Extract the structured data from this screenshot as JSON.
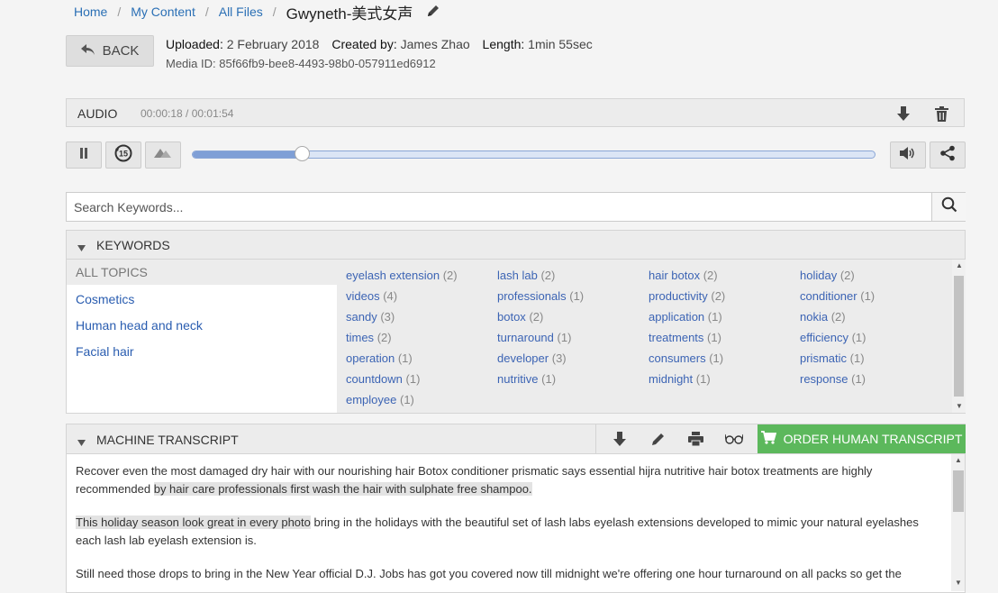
{
  "breadcrumb": {
    "items": [
      "Home",
      "My Content",
      "All Files"
    ],
    "current": "Gwyneth-美式女声",
    "separator": "/"
  },
  "back_button": {
    "label": "BACK"
  },
  "media_info": {
    "uploaded_label": "Uploaded:",
    "uploaded_value": "2 February 2018",
    "created_label": "Created by:",
    "created_value": "James Zhao",
    "length_label": "Length:",
    "length_value": "1min 55sec",
    "media_id": "Media ID: 85f66fb9-bee8-4493-98b0-057911ed6912"
  },
  "audio": {
    "label": "AUDIO",
    "time": "00:00:18 / 00:01:54",
    "progress": 0.16,
    "skip_back_seconds": "15"
  },
  "search": {
    "placeholder": "Search Keywords..."
  },
  "keywords": {
    "header": "KEYWORDS",
    "all_topics": "ALL TOPICS",
    "topics": [
      "Cosmetics",
      "Human head and neck",
      "Facial hair"
    ],
    "columns": [
      [
        {
          "term": "eyelash extension",
          "count": "(2)"
        },
        {
          "term": "videos",
          "count": "(4)"
        },
        {
          "term": "sandy",
          "count": "(3)"
        },
        {
          "term": "times",
          "count": "(2)"
        },
        {
          "term": "operation",
          "count": "(1)"
        },
        {
          "term": "countdown",
          "count": "(1)"
        },
        {
          "term": "employee",
          "count": "(1)"
        }
      ],
      [
        {
          "term": "lash lab",
          "count": "(2)"
        },
        {
          "term": "professionals",
          "count": "(1)"
        },
        {
          "term": "botox",
          "count": "(2)"
        },
        {
          "term": "turnaround",
          "count": "(1)"
        },
        {
          "term": "developer",
          "count": "(3)"
        },
        {
          "term": "nutritive",
          "count": "(1)"
        }
      ],
      [
        {
          "term": "hair botox",
          "count": "(2)"
        },
        {
          "term": "productivity",
          "count": "(2)"
        },
        {
          "term": "application",
          "count": "(1)"
        },
        {
          "term": "treatments",
          "count": "(1)"
        },
        {
          "term": "consumers",
          "count": "(1)"
        },
        {
          "term": "midnight",
          "count": "(1)"
        }
      ],
      [
        {
          "term": "holiday",
          "count": "(2)"
        },
        {
          "term": "conditioner",
          "count": "(1)"
        },
        {
          "term": "nokia",
          "count": "(2)"
        },
        {
          "term": "efficiency",
          "count": "(1)"
        },
        {
          "term": "prismatic",
          "count": "(1)"
        },
        {
          "term": "response",
          "count": "(1)"
        }
      ]
    ]
  },
  "transcript": {
    "header": "MACHINE TRANSCRIPT",
    "order_button": "ORDER HUMAN TRANSCRIPT",
    "p1_a": "Recover even the most damaged dry hair with our nourishing hair Botox conditioner prismatic says essential hijra nutritive hair botox treatments are highly recommended ",
    "p1_b": "by hair care professionals first wash the hair with sulphate free shampoo.",
    "p2_a": "This holiday season look great in every photo",
    "p2_b": " bring in the holidays with the beautiful set of lash labs eyelash extensions developed to mimic your natural eyelashes each lash lab eyelash extension is.",
    "p3": "Still need those drops to bring in the New Year official D.J. Jobs has got you covered now till midnight we're offering one hour turnaround on all packs so get the"
  },
  "colors": {
    "link": "#2a6fb5",
    "keyword": "#3c64b4",
    "order_button": "#5cb85c",
    "progress_fill": "#7f9fd6"
  },
  "icons": [
    "pencil-icon",
    "back-arrow-icon",
    "download-icon",
    "trash-icon",
    "pause-icon",
    "replay-15-icon",
    "speed-icon",
    "volume-icon",
    "share-icon",
    "search-icon",
    "triangle-down-icon",
    "print-icon",
    "glasses-icon",
    "cart-icon"
  ]
}
